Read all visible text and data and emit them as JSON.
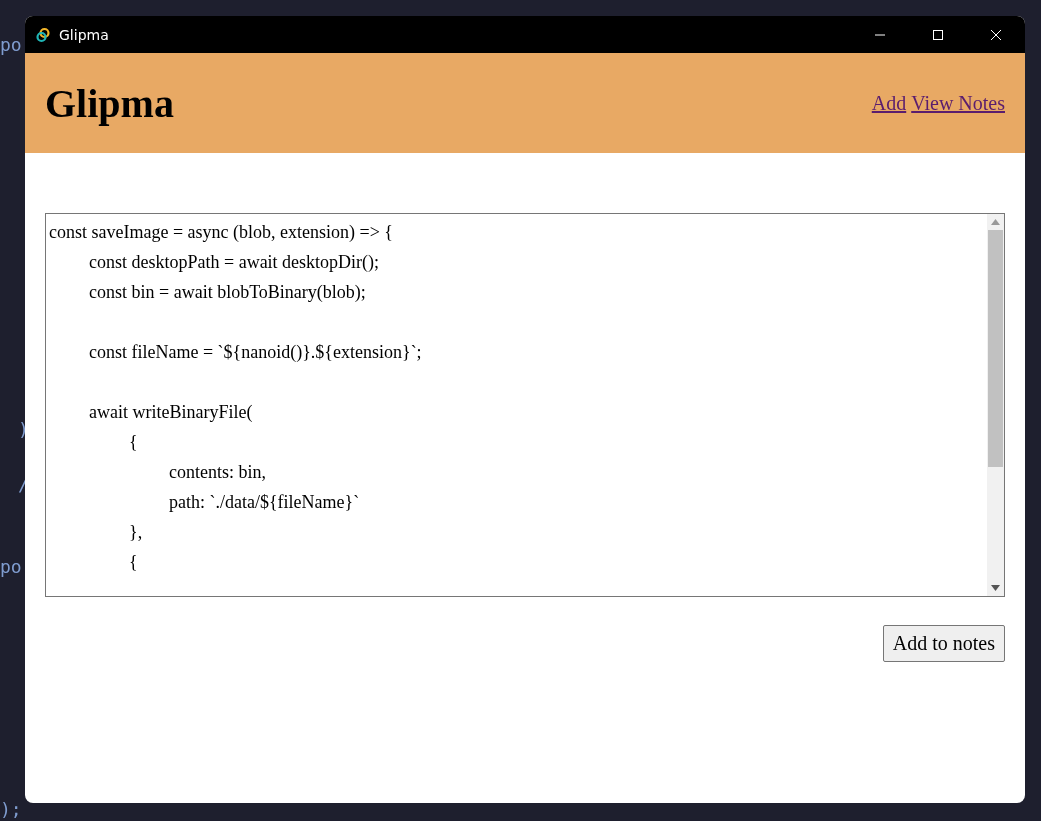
{
  "background_code": [
    "po",
    ")",
    "/",
    "po",
    ");"
  ],
  "window": {
    "title": "Glipma"
  },
  "header": {
    "title": "Glipma",
    "links": [
      "Add",
      "View Notes"
    ]
  },
  "note_field": {
    "value": "const saveImage = async (blob, extension) => {\n\tconst desktopPath = await desktopDir();\n\tconst bin = await blobToBinary(blob);\n\n\tconst fileName = `${nanoid()}.${extension}`;\n\n\tawait writeBinaryFile(\n\t\t{\n\t\t\tcontents: bin,\n\t\t\tpath: `./data/${fileName}`\n\t\t},\n\t\t{"
  },
  "buttons": [
    "Add to notes"
  ]
}
